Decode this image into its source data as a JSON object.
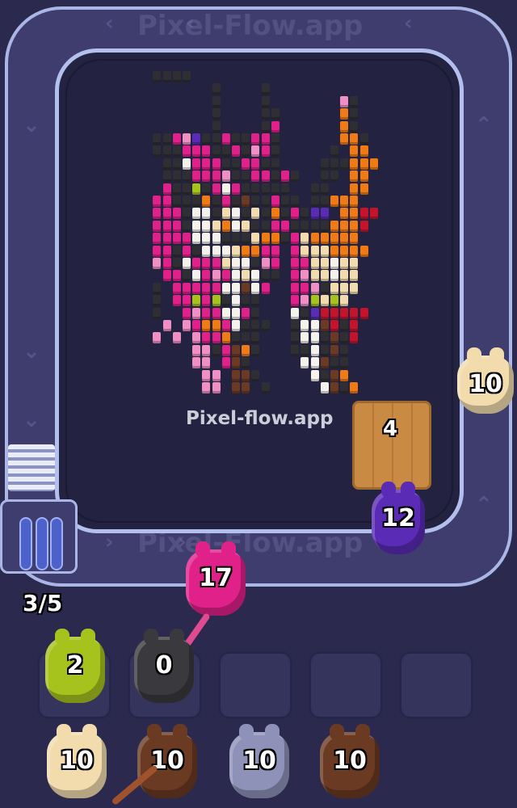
{
  "watermark": {
    "text": "Pixel-flow.app",
    "track_text": "Pixel-Flow.app"
  },
  "queue": {
    "counter": "3/5"
  },
  "crate": {
    "count": "4"
  },
  "side_shooter": {
    "count": "10",
    "color": "#f2dcae"
  },
  "belt_shooters": [
    {
      "count": "17",
      "color": "#e0218a"
    },
    {
      "count": "12",
      "color": "#5a2bb5"
    }
  ],
  "slot_shooters": [
    {
      "count": "2",
      "color": "#a6c21c"
    },
    {
      "count": "0",
      "color": "#3a3a3e"
    }
  ],
  "bottom_shooters": [
    {
      "count": "10",
      "color": "#f2dcae"
    },
    {
      "count": "10",
      "color": "#6b3a22"
    },
    {
      "count": "10",
      "color": "#8e92b8"
    },
    {
      "count": "10",
      "color": "#6b3a22"
    }
  ],
  "palette": {
    "k": "#2f2f33",
    "m": "#e0218a",
    "p": "#f08fc4",
    "o": "#f07a14",
    "w": "#f4f2ea",
    "c": "#f2dcae",
    "r": "#c4142c",
    "b": "#6b3a22",
    "l": "#a6c21c",
    "v": "#5a2bb5",
    "g": "#8e92b8"
  }
}
